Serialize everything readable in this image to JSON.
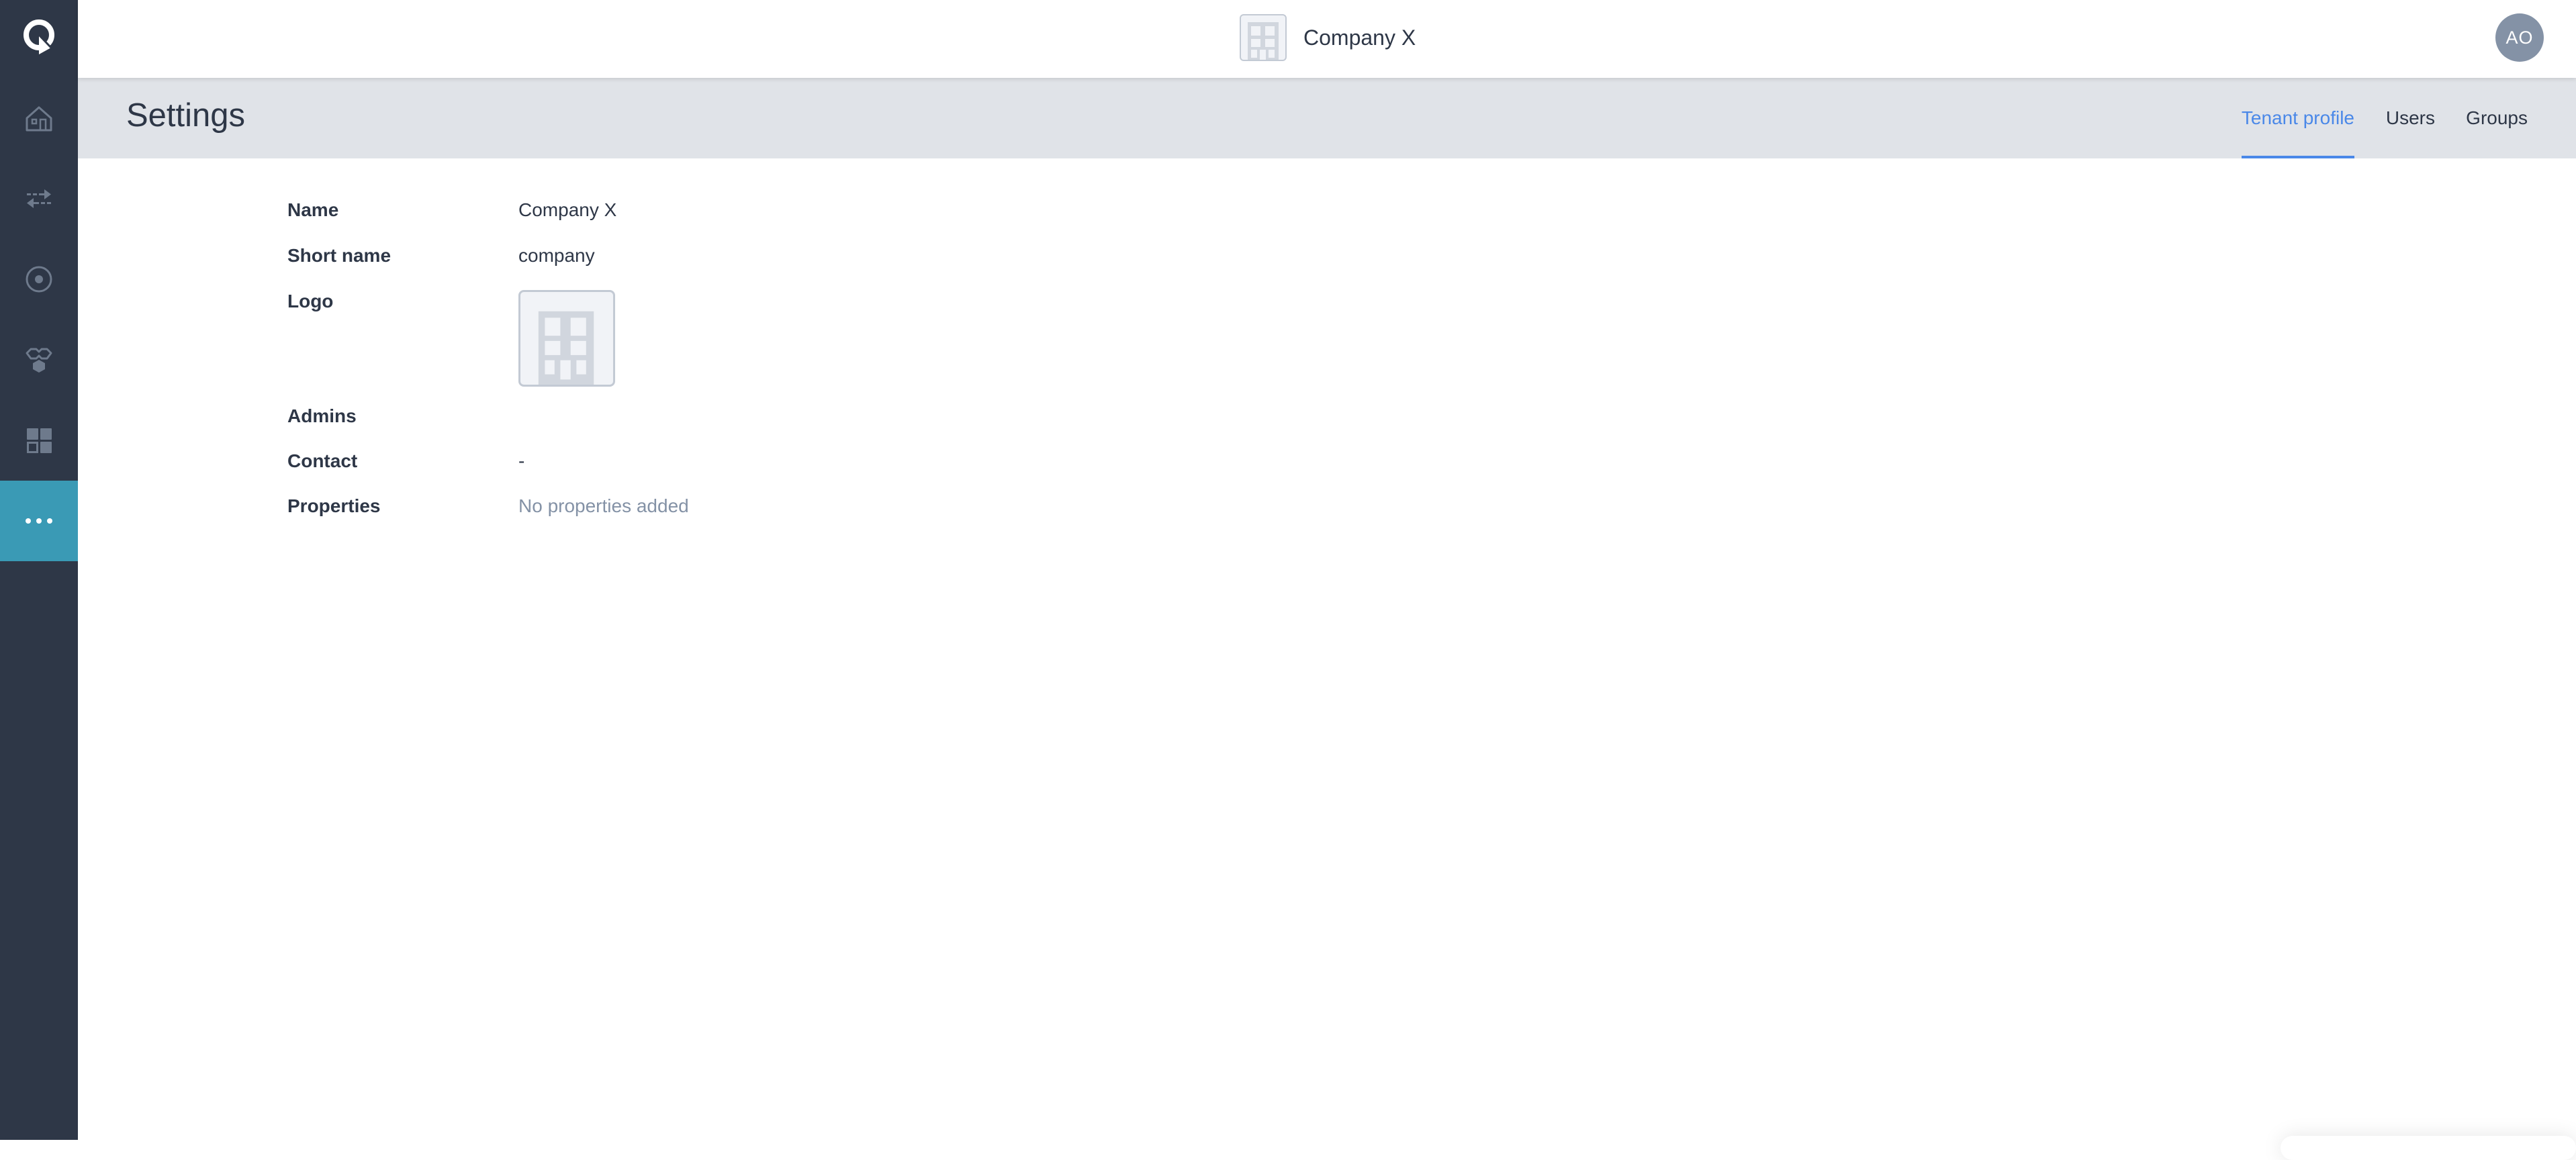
{
  "sidebar": {
    "logo_icon": "qlik-logo-icon",
    "items": [
      {
        "id": "home",
        "icon": "home-icon",
        "active": false
      },
      {
        "id": "transfer",
        "icon": "transfer-arrows-icon",
        "active": false
      },
      {
        "id": "target",
        "icon": "target-icon",
        "active": false
      },
      {
        "id": "network",
        "icon": "network-icon",
        "active": false
      },
      {
        "id": "apps",
        "icon": "apps-grid-icon",
        "active": false
      },
      {
        "id": "more",
        "icon": "more-dots-icon",
        "active": true
      }
    ],
    "active_color": "#3a9ab5"
  },
  "header": {
    "tenant_logo_icon": "building-icon",
    "tenant_name": "Company X",
    "avatar_initials": "AO",
    "avatar_color": "#8492a6"
  },
  "page": {
    "title": "Settings",
    "tabs": [
      {
        "label": "Tenant profile",
        "active": true
      },
      {
        "label": "Users",
        "active": false
      },
      {
        "label": "Groups",
        "active": false
      }
    ],
    "accent_color": "#4a88e8"
  },
  "profile": {
    "fields": [
      {
        "label": "Name",
        "value": "Company X"
      },
      {
        "label": "Short name",
        "value": "company"
      },
      {
        "label": "Logo",
        "value": "building-icon"
      },
      {
        "label": "Admins",
        "value": ""
      },
      {
        "label": "Contact",
        "value": "-"
      },
      {
        "label": "Properties",
        "value": "No properties added"
      }
    ]
  }
}
